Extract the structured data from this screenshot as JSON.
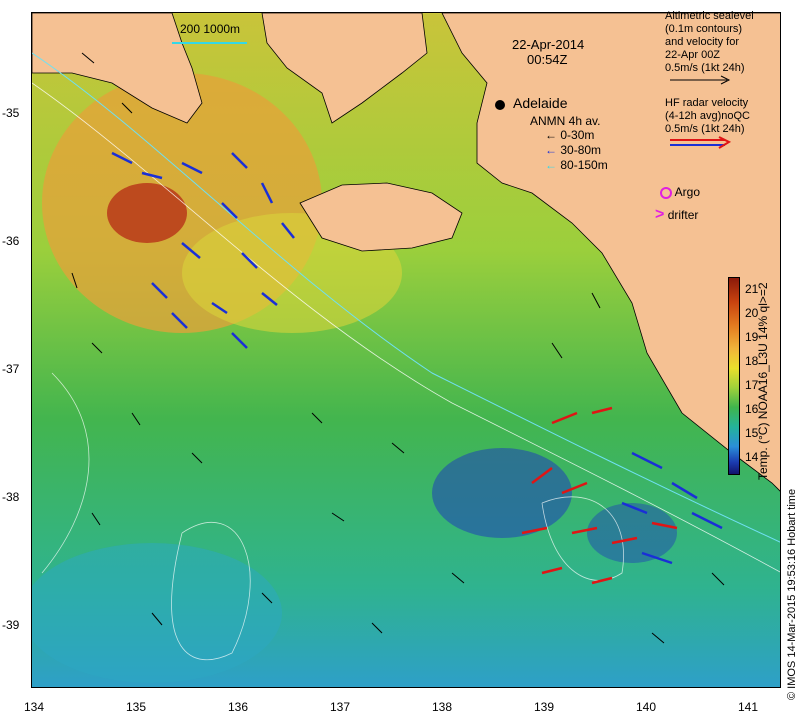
{
  "map": {
    "extent": {
      "lon": [
        134,
        141.33
      ],
      "lat": [
        -39.5,
        -34.42
      ]
    },
    "land_color": "#f5c193",
    "x_ticks": [
      "134",
      "135",
      "136",
      "137",
      "138",
      "139",
      "140",
      "141"
    ],
    "y_ticks": [
      "-35",
      "-36",
      "-37",
      "-38",
      "-39"
    ]
  },
  "annotations": {
    "date": "22-Apr-2014",
    "time": "00:54Z",
    "scale_bar": "200  1000m",
    "city": "Adelaide",
    "anmn_title": "ANMN 4h av.",
    "anmn_items": [
      {
        "label": "0-30m",
        "color": "#000000"
      },
      {
        "label": "30-80m",
        "color": "#1a2fd6"
      },
      {
        "label": "80-150m",
        "color": "#33d8e8"
      }
    ],
    "argo": "Argo",
    "drifter": "drifter"
  },
  "legend": {
    "altimetry_lines": [
      "Altimetric sealevel",
      "(0.1m contours)",
      "and velocity for",
      "22-Apr 00Z",
      "0.5m/s (1kt 24h)"
    ],
    "hf_lines": [
      "HF radar velocity",
      "(4-12h avg)noQC",
      "0.5m/s (1kt 24h)"
    ]
  },
  "colorbar": {
    "ticks": [
      "21",
      "20",
      "19",
      "18",
      "17",
      "16",
      "15",
      "14"
    ],
    "title": "Temp. (°C) NOAA16_L3U 14% ql>=2",
    "colors": [
      "#8b1a0a",
      "#e37a1f",
      "#e9e02c",
      "#3fb54d",
      "#2a8fd8",
      "#12146b"
    ]
  },
  "footer": "© IMOS 14-Mar-2015 19:53:16 Hobart time"
}
